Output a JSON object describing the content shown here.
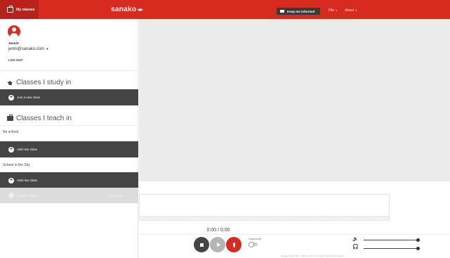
{
  "header": {
    "my_classes": "My classes",
    "logo": "sanako",
    "logo_arrows": "◂▸",
    "keep_informed": "Keep me informed",
    "menu": [
      {
        "label": "File",
        "caret": "▾"
      },
      {
        "label": "About",
        "caret": "▾"
      }
    ]
  },
  "user": {
    "name": "JenniS",
    "email": "jenni@sanako.com",
    "email_caret": "▾",
    "logout": "LOG OUT"
  },
  "study": {
    "heading": "Classes I study in",
    "join_label": "Join a new class"
  },
  "teach": {
    "heading": "Classes I teach in",
    "schools": [
      {
        "name": "No school",
        "add_label": "Add new class"
      },
      {
        "name": "School in the Sky",
        "add_label": "Add new class"
      }
    ],
    "class_item": {
      "name": "Sanako Class 2",
      "students": "10 students",
      "more": "⋮"
    }
  },
  "player": {
    "time": "0:00 / 0:00",
    "voice_insert": "Voice insert",
    "volume_icon": "🔉",
    "headphones_icon": "🎧"
  },
  "footer": {
    "text": "Sanako Study 1200 · Version 5.0.0 · Copyright Sanako Corporation"
  },
  "colors": {
    "brand": "#d72b1f",
    "dark": "#454545",
    "stage": "#ebebeb"
  }
}
